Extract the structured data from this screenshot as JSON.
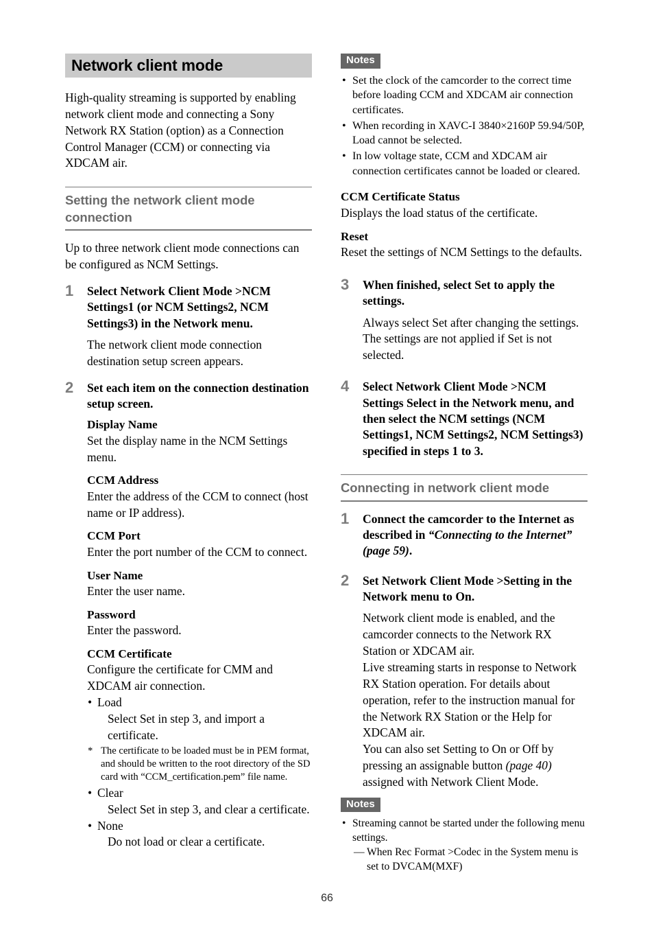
{
  "page": {
    "number": "66",
    "title": "Network client mode"
  },
  "left": {
    "intro": "High-quality streaming is supported by enabling network client mode and connecting a Sony Network RX Station (option) as a Connection Control Manager (CCM) or connecting via XDCAM air.",
    "section_heading": "Setting the network client mode connection",
    "section_intro": "Up to three network client mode connections can be configured as NCM Settings.",
    "step1": {
      "num": "1",
      "title": "Select Network Client Mode >NCM Settings1 (or NCM Settings2, NCM Settings3) in the Network menu.",
      "body": "The network client mode connection destination setup screen appears."
    },
    "step2": {
      "num": "2",
      "title": "Set each item on the connection destination setup screen.",
      "defs": [
        {
          "term": "Display Name",
          "desc": "Set the display name in the NCM Settings menu."
        },
        {
          "term": "CCM Address",
          "desc": "Enter the address of the CCM to connect (host name or IP address)."
        },
        {
          "term": "CCM Port",
          "desc": "Enter the port number of the CCM to connect."
        },
        {
          "term": "User Name",
          "desc": "Enter the user name."
        },
        {
          "term": "Password",
          "desc": "Enter the password."
        }
      ],
      "certificate": {
        "term": "CCM Certificate",
        "desc": "Configure the certificate for CMM and XDCAM air connection.",
        "bullet_mark": "•",
        "items": [
          {
            "label": "Load",
            "detail": "Select Set in step 3, and import a certificate."
          },
          {
            "label": "Clear",
            "detail": "Select Set in step 3, and clear a certificate."
          },
          {
            "label": "None",
            "detail": "Do not load or clear a certificate."
          }
        ],
        "footnote_mark": "*",
        "footnote": "The certificate to be loaded must be in PEM format, and should be written to the root directory of the SD card with “CCM_certification.pem” file name."
      }
    }
  },
  "right": {
    "notes_top": {
      "badge": "Notes",
      "bullet_mark": "•",
      "items": [
        "Set the clock of the camcorder to the correct time before loading CCM and XDCAM air connection certificates.",
        "When recording in XAVC-I 3840×2160P 59.94/50P, Load cannot be selected.",
        "In low voltage state, CCM and XDCAM air connection certificates cannot be loaded or cleared."
      ]
    },
    "defs": [
      {
        "term": "CCM Certificate Status",
        "desc": "Displays the load status of the certificate."
      },
      {
        "term": "Reset",
        "desc": "Reset the settings of NCM Settings to the defaults."
      }
    ],
    "step3": {
      "num": "3",
      "title": "When finished, select Set to apply the settings.",
      "body": "Always select Set after changing the settings. The settings are not applied if Set is not selected."
    },
    "step4": {
      "num": "4",
      "title": "Select Network Client Mode >NCM Settings Select in the Network menu, and then select the NCM settings (NCM Settings1, NCM Settings2, NCM Settings3) specified in steps 1 to 3."
    },
    "section_heading": "Connecting in network client mode",
    "conn_step1": {
      "num": "1",
      "title_pre": "Connect the camcorder to the Internet as described in ",
      "title_ref": "“Connecting to the Internet” (page 59)",
      "title_post": "."
    },
    "conn_step2": {
      "num": "2",
      "title": "Set Network Client Mode >Setting in the Network menu to On.",
      "body1": "Network client mode is enabled, and the camcorder connects to the Network RX Station or XDCAM air.",
      "body2": "Live streaming starts in response to Network RX Station operation. For details about operation, refer to the instruction manual for the Network RX Station or the Help for XDCAM air.",
      "body3_pre": "You can also set Setting to On or Off by pressing an assignable button ",
      "body3_ref": "(page 40)",
      "body3_post": " assigned with Network Client Mode."
    },
    "notes_bottom": {
      "badge": "Notes",
      "bullet_mark": "•",
      "item": "Streaming cannot be started under the following menu settings.",
      "dash_mark": "—",
      "sub_item": "When Rec Format >Codec in the System menu is set to DVCAM(MXF)"
    }
  }
}
